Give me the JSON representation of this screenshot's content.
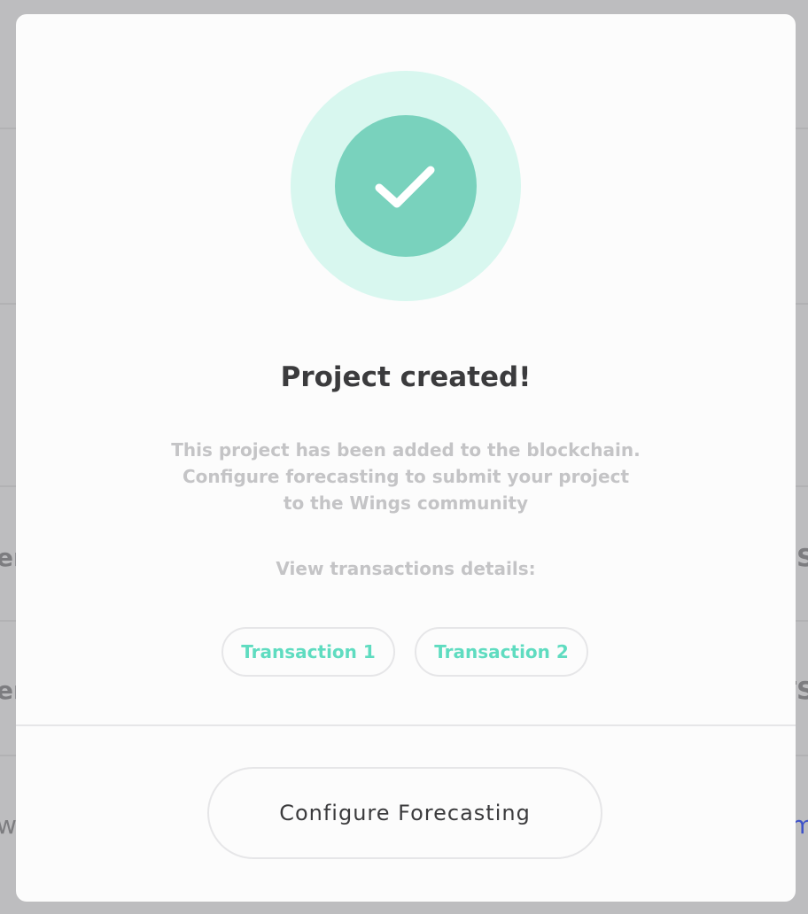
{
  "background": {
    "left_fragments": [
      "er",
      "er",
      "we"
    ],
    "right_fragments": [
      "ES",
      "TS",
      "m"
    ]
  },
  "modal": {
    "success_icon": "check-icon",
    "title": "Project created!",
    "description_lines": [
      "This project has been added to the blockchain.",
      "Configure forecasting to submit your project",
      "to the Wings community"
    ],
    "view_label": "View transactions details:",
    "transactions": [
      {
        "label": "Transaction 1"
      },
      {
        "label": "Transaction 2"
      }
    ],
    "primary_button_label": "Configure Forecasting"
  },
  "colors": {
    "accent": "#5fdcc0",
    "success_circle": "#79d2bd",
    "success_halo": "#d8f7ef",
    "overlay": "#bdbdbf"
  }
}
